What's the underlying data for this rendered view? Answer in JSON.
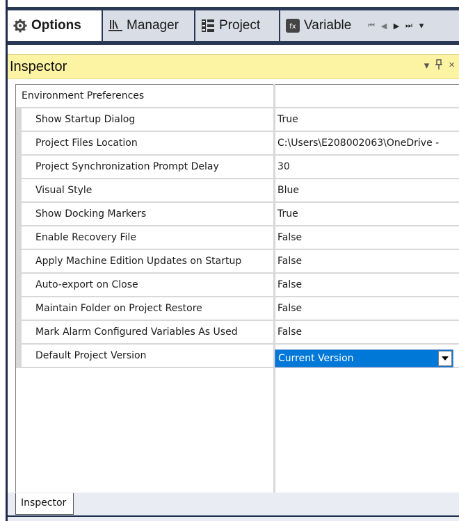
{
  "tabs": [
    {
      "label": "Options",
      "icon": "gear-icon",
      "active": true
    },
    {
      "label": "Manager",
      "icon": "manager-icon",
      "active": false
    },
    {
      "label": "Project",
      "icon": "project-icon",
      "active": false
    },
    {
      "label": "Variable",
      "icon": "variable-icon",
      "active": false
    }
  ],
  "tab_nav": {
    "first": "⏮",
    "prev": "◀",
    "next": "▶",
    "last": "⏭",
    "menu": "⏷"
  },
  "panel": {
    "title": "Inspector",
    "dropdown_icon": "▾",
    "pin_icon": "📌",
    "close_icon": "×"
  },
  "properties": {
    "category": "Environment Preferences",
    "rows": [
      {
        "name": "Show Startup Dialog",
        "value": "True"
      },
      {
        "name": "Project Files Location",
        "value": "C:\\Users\\E208002063\\OneDrive -"
      },
      {
        "name": "Project Synchronization Prompt Delay",
        "value": "30"
      },
      {
        "name": "Visual Style",
        "value": "Blue"
      },
      {
        "name": "Show Docking Markers",
        "value": "True"
      },
      {
        "name": "Enable Recovery File",
        "value": "False"
      },
      {
        "name": "Apply Machine Edition Updates on Startup",
        "value": "False"
      },
      {
        "name": "Auto-export on Close",
        "value": "False"
      },
      {
        "name": "Maintain Folder on Project Restore",
        "value": "False"
      },
      {
        "name": "Mark Alarm Configured Variables As Used",
        "value": "False"
      },
      {
        "name": "Default Project Version",
        "value": "Current Version"
      }
    ]
  },
  "bottom_tab": {
    "label": "Inspector"
  },
  "colors": {
    "title_bar": "#fdf4a3",
    "tab_strip": "#293955",
    "selection": "#0078d7"
  }
}
